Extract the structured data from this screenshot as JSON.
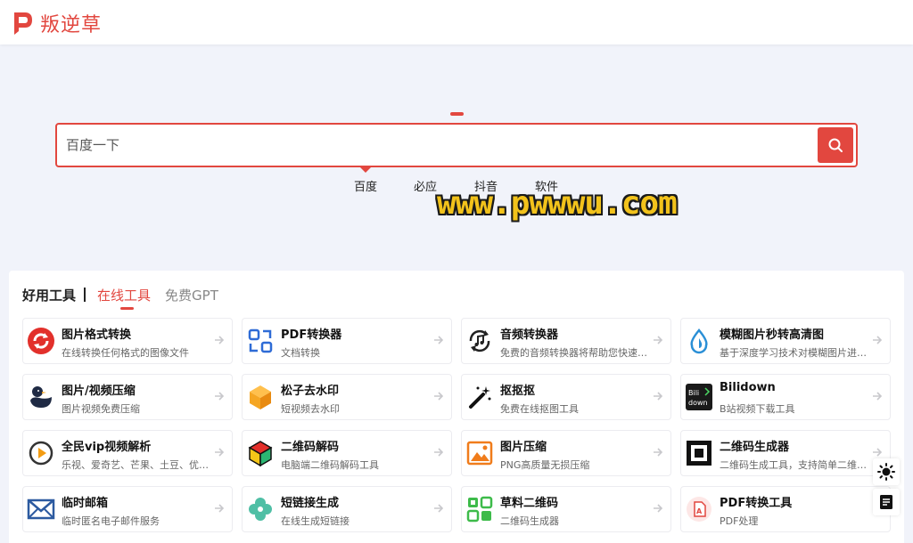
{
  "header": {
    "logo_text": "叛逆草",
    "brand_color": "#e2473f"
  },
  "search": {
    "placeholder": "百度一下"
  },
  "engines": [
    "百度",
    "必应",
    "抖音",
    "软件"
  ],
  "watermark": "www.pwwwu.com",
  "tabs": {
    "title": "好用工具",
    "active": "在线工具",
    "other": "免费GPT"
  },
  "tools": [
    {
      "title": "图片格式转换",
      "desc": "在线转换任何格式的图像文件",
      "icon": "refresh-circle-icon"
    },
    {
      "title": "PDF转换器",
      "desc": "文档转换",
      "icon": "convert-arrows-icon"
    },
    {
      "title": "音频转换器",
      "desc": "免费的音频转换器将帮助您快速转换音频文件",
      "icon": "music-note-icon"
    },
    {
      "title": "模糊图片秒转高清图",
      "desc": "基于深度学习技术对模糊图片进行修复",
      "icon": "water-drop-icon"
    },
    {
      "title": "图片/视频压缩",
      "desc": "图片视频免费压缩",
      "icon": "duck-icon"
    },
    {
      "title": "松子去水印",
      "desc": "短视频去水印",
      "icon": "cube-icon"
    },
    {
      "title": "抠抠抠",
      "desc": "免费在线抠图工具",
      "icon": "magic-wand-icon"
    },
    {
      "title": "Bilidown",
      "desc": "B站视频下载工具",
      "icon": "bilidown-logo-icon"
    },
    {
      "title": "全民vip视频解析",
      "desc": "乐视、爱奇艺、芒果、土豆、优酷、腾讯视频",
      "icon": "play-circle-icon"
    },
    {
      "title": "二维码解码",
      "desc": "电脑端二维码解码工具",
      "icon": "color-cube-icon"
    },
    {
      "title": "图片压缩",
      "desc": "PNG高质量无损压缩",
      "icon": "image-mountain-icon"
    },
    {
      "title": "二维码生成器",
      "desc": "二维码生成工具，支持简单二维码与活码",
      "icon": "qr-frame-icon"
    },
    {
      "title": "临时邮箱",
      "desc": "临时匿名电子邮件服务",
      "icon": "mail-icon"
    },
    {
      "title": "短链接生成",
      "desc": "在线生成短链接",
      "icon": "flower-icon"
    },
    {
      "title": "草料二维码",
      "desc": "二维码生成器",
      "icon": "qr-green-icon"
    },
    {
      "title": "PDF转换工具",
      "desc": "PDF处理",
      "icon": "pdf-icon"
    }
  ]
}
